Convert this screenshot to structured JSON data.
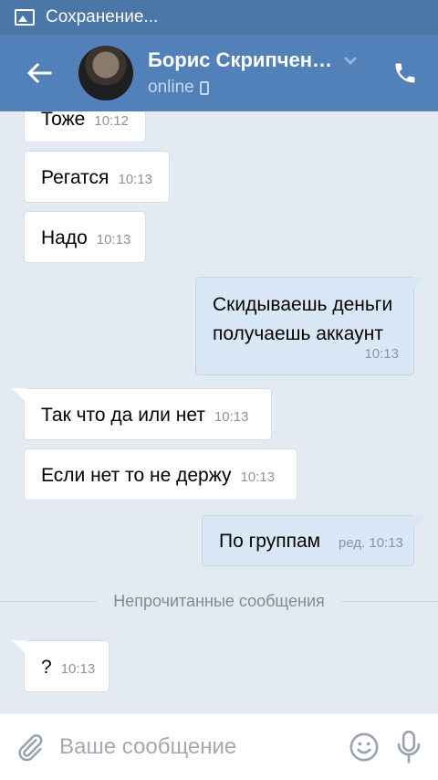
{
  "statusbar": {
    "text": "Сохранение..."
  },
  "header": {
    "name": "Борис Скрипчен…",
    "status": "online"
  },
  "messages": [
    {
      "dir": "in",
      "text": "Тоже",
      "time": "10:12"
    },
    {
      "dir": "in",
      "text": "Регатся",
      "time": "10:13"
    },
    {
      "dir": "in",
      "text": "Надо",
      "time": "10:13"
    },
    {
      "dir": "out",
      "line1": "Скидываешь деньги",
      "line2": "получаешь аккаунт",
      "time": "10:13"
    },
    {
      "dir": "in",
      "text": "Так что да или нет",
      "time": "10:13"
    },
    {
      "dir": "in",
      "text": "Если  нет то не держу",
      "time": "10:13"
    },
    {
      "dir": "out",
      "text": "По группам",
      "time": "ред. 10:13"
    },
    {
      "dir": "in",
      "text": "?",
      "time": "10:13"
    }
  ],
  "separator": {
    "label": "Непрочитанные сообщения"
  },
  "composer": {
    "placeholder": "Ваше сообщение"
  },
  "colors": {
    "header": "#5181b8",
    "statusbar": "#4a76a8",
    "background": "#e4eaf1",
    "outgoing": "#dae7f6"
  }
}
